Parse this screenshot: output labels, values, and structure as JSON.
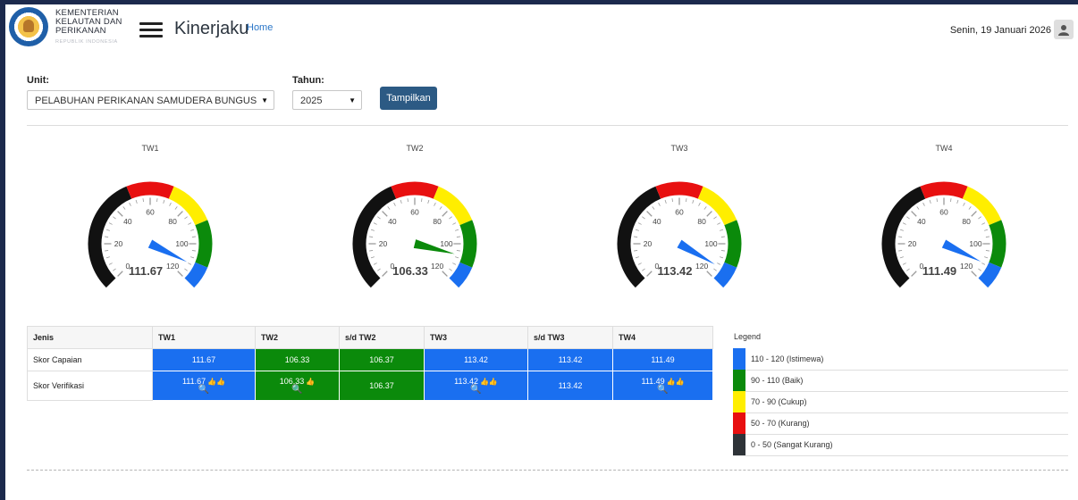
{
  "header": {
    "logo_lines": [
      "KEMENTERIAN",
      "KELAUTAN DAN",
      "PERIKANAN"
    ],
    "logo_sub": "REPUBLIK INDONESIA",
    "app_title": "Kinerjaku",
    "home_link": "Home",
    "date": "Senin, 19 Januari 2026"
  },
  "filters": {
    "unit_label": "Unit:",
    "unit_value": "PELABUHAN PERIKANAN SAMUDERA BUNGUS",
    "tahun_label": "Tahun:",
    "tahun_value": "2025",
    "submit_label": "Tampilkan"
  },
  "gauges": [
    {
      "label": "TW1",
      "value": 111.67,
      "value_text": "111.67",
      "needle_color": "#1a6ff0"
    },
    {
      "label": "TW2",
      "value": 106.33,
      "value_text": "106.33",
      "needle_color": "#0b8a0b"
    },
    {
      "label": "TW3",
      "value": 113.42,
      "value_text": "113.42",
      "needle_color": "#1a6ff0"
    },
    {
      "label": "TW4",
      "value": 111.49,
      "value_text": "111.49",
      "needle_color": "#1a6ff0"
    }
  ],
  "gauge_scale": {
    "min": 0,
    "max": 120,
    "tick_labels": [
      "0",
      "20",
      "40",
      "60",
      "80",
      "100",
      "120"
    ],
    "bands": [
      {
        "from": 0,
        "to": 50,
        "color": "#111111"
      },
      {
        "from": 50,
        "to": 70,
        "color": "#e81010"
      },
      {
        "from": 70,
        "to": 90,
        "color": "#ffee00"
      },
      {
        "from": 90,
        "to": 110,
        "color": "#0b8a0b"
      },
      {
        "from": 110,
        "to": 120,
        "color": "#1a6ff0"
      }
    ]
  },
  "table": {
    "headers": [
      "Jenis",
      "TW1",
      "TW2",
      "s/d TW2",
      "TW3",
      "s/d TW3",
      "TW4"
    ],
    "rows": [
      {
        "label": "Skor Capaian",
        "cells": [
          {
            "text": "111.67",
            "color": "blue",
            "icons": ""
          },
          {
            "text": "106.33",
            "color": "green",
            "icons": ""
          },
          {
            "text": "106.37",
            "color": "green",
            "icons": ""
          },
          {
            "text": "113.42",
            "color": "blue",
            "icons": ""
          },
          {
            "text": "113.42",
            "color": "blue",
            "icons": ""
          },
          {
            "text": "111.49",
            "color": "blue",
            "icons": ""
          }
        ]
      },
      {
        "label": "Skor Verifikasi",
        "cells": [
          {
            "text": "111.67",
            "color": "blue",
            "icons": "👍👍",
            "search": true
          },
          {
            "text": "106.33",
            "color": "green",
            "icons": "👍",
            "search": true
          },
          {
            "text": "106.37",
            "color": "green",
            "icons": "",
            "search": false
          },
          {
            "text": "113.42",
            "color": "blue",
            "icons": "👍👍",
            "search": true
          },
          {
            "text": "113.42",
            "color": "blue",
            "icons": "",
            "search": false
          },
          {
            "text": "111.49",
            "color": "blue",
            "icons": "👍👍",
            "search": true
          }
        ]
      }
    ]
  },
  "legend": {
    "title": "Legend",
    "items": [
      {
        "label": "110 - 120 (Istimewa)",
        "color": "#1a6ff0"
      },
      {
        "label": "90 - 110 (Baik)",
        "color": "#0b8a0b"
      },
      {
        "label": "70 - 90 (Cukup)",
        "color": "#ffee00"
      },
      {
        "label": "50 - 70 (Kurang)",
        "color": "#e81010"
      },
      {
        "label": "0 - 50 (Sangat Kurang)",
        "color": "#2e3338"
      }
    ]
  }
}
